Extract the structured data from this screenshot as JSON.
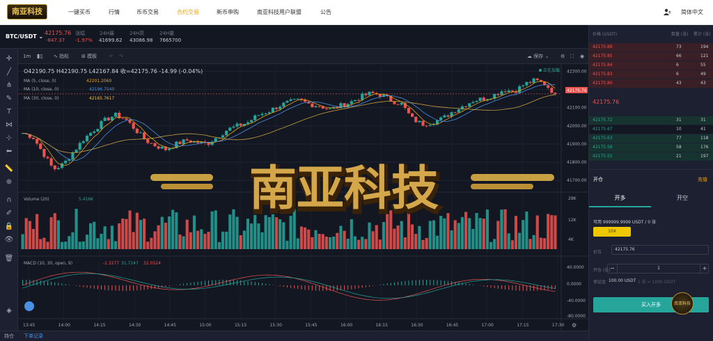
{
  "nav": {
    "logo": "南亚科技",
    "items": [
      {
        "label": "一键买币",
        "active": false
      },
      {
        "label": "行情",
        "active": false
      },
      {
        "label": "币币交易",
        "active": false
      },
      {
        "label": "合约交易",
        "active": true
      },
      {
        "label": "新币申购",
        "active": false
      },
      {
        "label": "南亚科技用户联盟",
        "active": false
      },
      {
        "label": "公告",
        "active": false
      }
    ],
    "language": "简体中文"
  },
  "ticker": {
    "pair": "BTC/USDT",
    "price": "42175.76",
    "change": "-847.37",
    "change_label": "涨幅",
    "change_pct": "-1.97%",
    "high_label": "24H最",
    "high": "41699.62",
    "low_label": "24H高",
    "low": "43086.98",
    "vol_label": "24H量",
    "vol": "7665700"
  },
  "chart_header": {
    "interval": "1m",
    "indicators": "指标",
    "template": "模板",
    "save": "保存"
  },
  "chart_legend": {
    "ohlc": "O42190.75  H42190.75  L42167.84  收=42175.76  -14.99 (-0.04%)",
    "ma5_label": "MA (5, close, 0)",
    "ma5_val": "42201.2060",
    "ma10_label": "MA (10, close, 0)",
    "ma10_val": "42196.7540",
    "ma30_label": "MA (30, close, 0)",
    "ma30_val": "42165.7617",
    "live_label": "正在加载",
    "current_price_tag": "42175.76",
    "volume_label": "Volume (20)",
    "volume_val": "5.416K",
    "macd_label": "MACD (10, 30, open, 9)",
    "macd_v1": "-1.3277",
    "macd_v2": "31.7247",
    "macd_v3": "32.0524"
  },
  "watermark": "南亚科技",
  "chart_data": {
    "type": "candlestick",
    "price_ticks": [
      "42300.00",
      "42200.00",
      "42100.00",
      "42000.00",
      "41900.00",
      "41800.00",
      "41700.00"
    ],
    "volume_ticks": [
      "28K",
      "12K",
      "4K"
    ],
    "macd_ticks": [
      "40.0000",
      "0.0000",
      "-40.0000",
      "-80.0000"
    ],
    "time_ticks": [
      "13:45",
      "14:00",
      "14:15",
      "14:30",
      "14:45",
      "15:00",
      "15:15",
      "15:30",
      "15:45",
      "16:00",
      "16:15",
      "16:30",
      "16:45",
      "17:00",
      "17:15",
      "17:30"
    ],
    "ylim": [
      41670,
      42325
    ],
    "close_path": [
      41960,
      41940,
      41850,
      41760,
      41790,
      41860,
      41930,
      41980,
      42030,
      42060,
      42040,
      41980,
      41920,
      41890,
      41870,
      41900,
      41920,
      41910,
      41900,
      41940,
      41980,
      42000,
      42020,
      42060,
      42080,
      42110,
      42130,
      42140,
      42120,
      42110,
      42090,
      42110,
      42130,
      42160,
      42180,
      42170,
      42140,
      42120,
      42040,
      42010,
      42020,
      42040,
      42080,
      42110,
      42140,
      42150,
      42170,
      42200,
      42190,
      42230,
      42250,
      42230,
      42175.76
    ]
  },
  "bottom": {
    "tab1": "持仓",
    "tab2": "下单记录"
  },
  "orderbook": {
    "headers": [
      "价格 (USDT)",
      "数量 (张)",
      "累计 (张)"
    ],
    "asks": [
      {
        "price": "42175.89",
        "qty": "73",
        "total": "194"
      },
      {
        "price": "42175.85",
        "qty": "66",
        "total": "121"
      },
      {
        "price": "42175.84",
        "qty": "6",
        "total": "55"
      },
      {
        "price": "42175.83",
        "qty": "6",
        "total": "49"
      },
      {
        "price": "42175.80",
        "qty": "43",
        "total": "43"
      }
    ],
    "mid": "42175.76",
    "bids": [
      {
        "price": "42175.72",
        "qty": "31",
        "total": "31"
      },
      {
        "price": "42175.67",
        "qty": "10",
        "total": "41"
      },
      {
        "price": "42175.63",
        "qty": "77",
        "total": "118"
      },
      {
        "price": "42175.58",
        "qty": "58",
        "total": "176"
      },
      {
        "price": "42175.55",
        "qty": "21",
        "total": "197"
      }
    ]
  },
  "trade": {
    "tab_open": "开仓",
    "tab_close": "平仓",
    "recharge": "充值",
    "long": "开多",
    "short": "开空",
    "available": "可用 999999.9999 USDT / 0 张",
    "leverage": "10X",
    "price_label": "价位",
    "price_value": "42175.76",
    "qty_label": "开仓 (张)",
    "qty_value": "1",
    "margin_label": "保证金",
    "margin_value": "100.00 USDT",
    "unit_note": "1 张 = 1000 USDT",
    "buy_button": "买入开多"
  },
  "colors": {
    "up": "#26a69a",
    "down": "#ef5350",
    "accent": "#e8a317",
    "panel": "#1c2030",
    "bg": "#131722"
  }
}
